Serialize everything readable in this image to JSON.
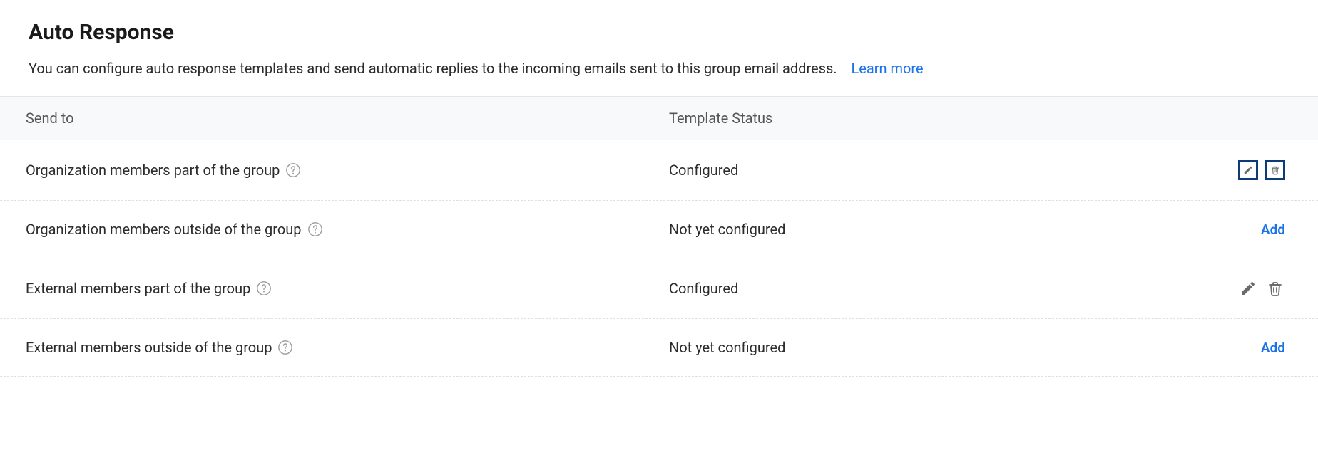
{
  "header": {
    "title": "Auto Response",
    "description": "You can configure auto response templates and send automatic replies to the incoming emails sent to this group email address.",
    "learn_more_label": "Learn more"
  },
  "table": {
    "columns": {
      "send_to": "Send to",
      "template_status": "Template Status"
    },
    "rows": [
      {
        "send_to": "Organization members part of the group",
        "status": "Configured",
        "action_type": "editdelete",
        "highlighted": true
      },
      {
        "send_to": "Organization members outside of the group",
        "status": "Not yet configured",
        "action_type": "add"
      },
      {
        "send_to": "External members part of the group",
        "status": "Configured",
        "action_type": "editdelete",
        "highlighted": false
      },
      {
        "send_to": "External members outside of the group",
        "status": "Not yet configured",
        "action_type": "add"
      }
    ],
    "add_label": "Add"
  }
}
